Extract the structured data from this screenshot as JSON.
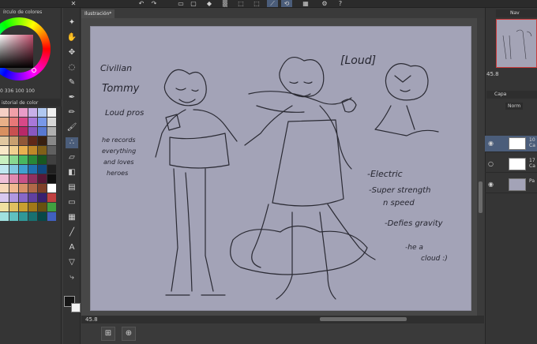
{
  "document": {
    "tab_label": "Ilustración*"
  },
  "panels": {
    "color_wheel_title": "írculo de colores",
    "color_history_title": "istorial de color",
    "hsv_readout": "0 336 100 100",
    "navigator_title": "Nav",
    "layers_title": "Capa",
    "blend_mode": "Norm"
  },
  "zoom": {
    "canvas": "45.8",
    "navigator": "45.8"
  },
  "layers": [
    {
      "name_line1": "10",
      "name_line2": "Ca",
      "visible": true,
      "active": true
    },
    {
      "name_line1": "17",
      "name_line2": "Ca",
      "visible": false,
      "active": false
    },
    {
      "name_line1": "Pa",
      "name_line2": "",
      "visible": true,
      "active": false
    }
  ],
  "sketch_text": {
    "civilian": "Civilian",
    "tommy": "Tommy",
    "loud_pros": "Loud pros",
    "note1": "he records",
    "note2": "everything",
    "note3": "and loves",
    "note4": "heroes",
    "hero_name": "[Loud]",
    "power1": "-Electric",
    "power2": "-Super strength",
    "power3": "n speed",
    "power4": "-Defies gravity",
    "power5": "-he a",
    "power6": "cloud :)"
  },
  "icons": {
    "tools": [
      "cursor-icon",
      "hand-icon",
      "move-icon",
      "lasso-icon",
      "eyedropper-icon",
      "pen-icon",
      "pencil-icon",
      "brush-icon",
      "airbrush-icon",
      "eraser-icon",
      "fill-icon",
      "gradient-icon",
      "figure-icon",
      "frame-icon",
      "ruler-icon",
      "text-icon",
      "balloon-icon",
      "correct-line-icon"
    ]
  }
}
